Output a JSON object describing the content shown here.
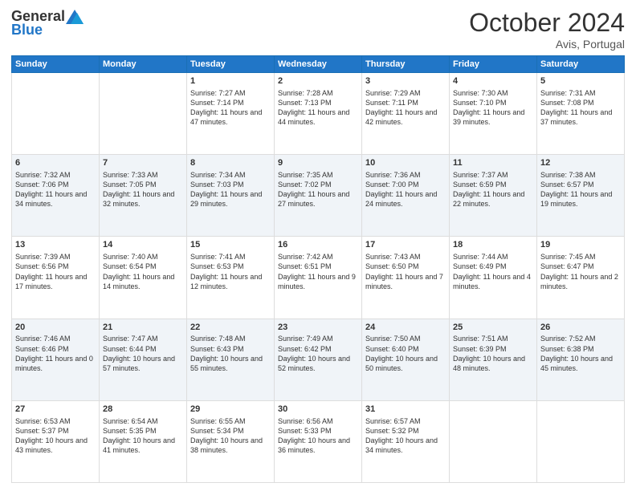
{
  "header": {
    "logo_general": "General",
    "logo_blue": "Blue",
    "month_title": "October 2024",
    "location": "Avis, Portugal"
  },
  "days_of_week": [
    "Sunday",
    "Monday",
    "Tuesday",
    "Wednesday",
    "Thursday",
    "Friday",
    "Saturday"
  ],
  "weeks": [
    [
      {
        "day": "",
        "info": ""
      },
      {
        "day": "",
        "info": ""
      },
      {
        "day": "1",
        "info": "Sunrise: 7:27 AM\nSunset: 7:14 PM\nDaylight: 11 hours and 47 minutes."
      },
      {
        "day": "2",
        "info": "Sunrise: 7:28 AM\nSunset: 7:13 PM\nDaylight: 11 hours and 44 minutes."
      },
      {
        "day": "3",
        "info": "Sunrise: 7:29 AM\nSunset: 7:11 PM\nDaylight: 11 hours and 42 minutes."
      },
      {
        "day": "4",
        "info": "Sunrise: 7:30 AM\nSunset: 7:10 PM\nDaylight: 11 hours and 39 minutes."
      },
      {
        "day": "5",
        "info": "Sunrise: 7:31 AM\nSunset: 7:08 PM\nDaylight: 11 hours and 37 minutes."
      }
    ],
    [
      {
        "day": "6",
        "info": "Sunrise: 7:32 AM\nSunset: 7:06 PM\nDaylight: 11 hours and 34 minutes."
      },
      {
        "day": "7",
        "info": "Sunrise: 7:33 AM\nSunset: 7:05 PM\nDaylight: 11 hours and 32 minutes."
      },
      {
        "day": "8",
        "info": "Sunrise: 7:34 AM\nSunset: 7:03 PM\nDaylight: 11 hours and 29 minutes."
      },
      {
        "day": "9",
        "info": "Sunrise: 7:35 AM\nSunset: 7:02 PM\nDaylight: 11 hours and 27 minutes."
      },
      {
        "day": "10",
        "info": "Sunrise: 7:36 AM\nSunset: 7:00 PM\nDaylight: 11 hours and 24 minutes."
      },
      {
        "day": "11",
        "info": "Sunrise: 7:37 AM\nSunset: 6:59 PM\nDaylight: 11 hours and 22 minutes."
      },
      {
        "day": "12",
        "info": "Sunrise: 7:38 AM\nSunset: 6:57 PM\nDaylight: 11 hours and 19 minutes."
      }
    ],
    [
      {
        "day": "13",
        "info": "Sunrise: 7:39 AM\nSunset: 6:56 PM\nDaylight: 11 hours and 17 minutes."
      },
      {
        "day": "14",
        "info": "Sunrise: 7:40 AM\nSunset: 6:54 PM\nDaylight: 11 hours and 14 minutes."
      },
      {
        "day": "15",
        "info": "Sunrise: 7:41 AM\nSunset: 6:53 PM\nDaylight: 11 hours and 12 minutes."
      },
      {
        "day": "16",
        "info": "Sunrise: 7:42 AM\nSunset: 6:51 PM\nDaylight: 11 hours and 9 minutes."
      },
      {
        "day": "17",
        "info": "Sunrise: 7:43 AM\nSunset: 6:50 PM\nDaylight: 11 hours and 7 minutes."
      },
      {
        "day": "18",
        "info": "Sunrise: 7:44 AM\nSunset: 6:49 PM\nDaylight: 11 hours and 4 minutes."
      },
      {
        "day": "19",
        "info": "Sunrise: 7:45 AM\nSunset: 6:47 PM\nDaylight: 11 hours and 2 minutes."
      }
    ],
    [
      {
        "day": "20",
        "info": "Sunrise: 7:46 AM\nSunset: 6:46 PM\nDaylight: 11 hours and 0 minutes."
      },
      {
        "day": "21",
        "info": "Sunrise: 7:47 AM\nSunset: 6:44 PM\nDaylight: 10 hours and 57 minutes."
      },
      {
        "day": "22",
        "info": "Sunrise: 7:48 AM\nSunset: 6:43 PM\nDaylight: 10 hours and 55 minutes."
      },
      {
        "day": "23",
        "info": "Sunrise: 7:49 AM\nSunset: 6:42 PM\nDaylight: 10 hours and 52 minutes."
      },
      {
        "day": "24",
        "info": "Sunrise: 7:50 AM\nSunset: 6:40 PM\nDaylight: 10 hours and 50 minutes."
      },
      {
        "day": "25",
        "info": "Sunrise: 7:51 AM\nSunset: 6:39 PM\nDaylight: 10 hours and 48 minutes."
      },
      {
        "day": "26",
        "info": "Sunrise: 7:52 AM\nSunset: 6:38 PM\nDaylight: 10 hours and 45 minutes."
      }
    ],
    [
      {
        "day": "27",
        "info": "Sunrise: 6:53 AM\nSunset: 5:37 PM\nDaylight: 10 hours and 43 minutes."
      },
      {
        "day": "28",
        "info": "Sunrise: 6:54 AM\nSunset: 5:35 PM\nDaylight: 10 hours and 41 minutes."
      },
      {
        "day": "29",
        "info": "Sunrise: 6:55 AM\nSunset: 5:34 PM\nDaylight: 10 hours and 38 minutes."
      },
      {
        "day": "30",
        "info": "Sunrise: 6:56 AM\nSunset: 5:33 PM\nDaylight: 10 hours and 36 minutes."
      },
      {
        "day": "31",
        "info": "Sunrise: 6:57 AM\nSunset: 5:32 PM\nDaylight: 10 hours and 34 minutes."
      },
      {
        "day": "",
        "info": ""
      },
      {
        "day": "",
        "info": ""
      }
    ]
  ]
}
